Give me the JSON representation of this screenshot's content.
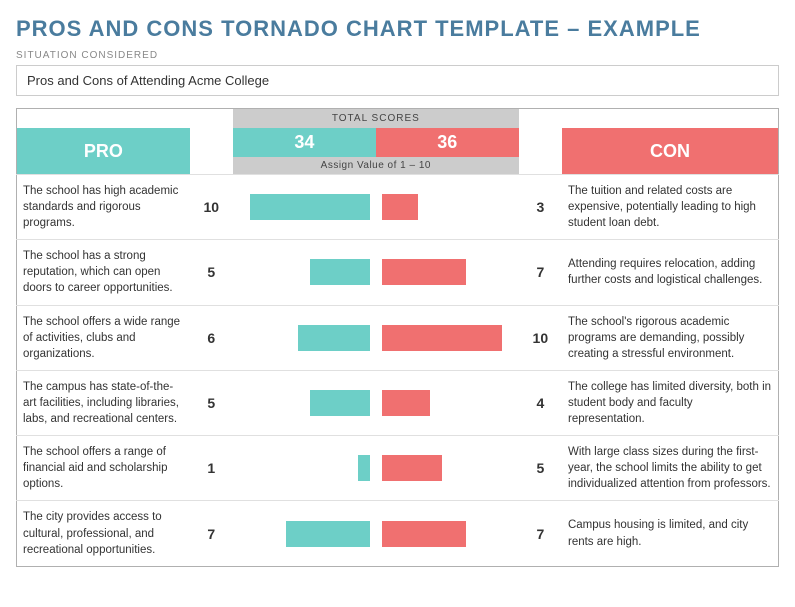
{
  "title": "PROS AND CONS TORNADO CHART TEMPLATE – EXAMPLE",
  "situation_label": "SITUATION CONSIDERED",
  "situation_value": "Pros and Cons of Attending Acme College",
  "total_scores_label": "TOTAL SCORES",
  "assign_value_label": "Assign Value of 1 – 10",
  "pro_label": "PRO",
  "con_label": "CON",
  "pro_total": "34",
  "con_total": "36",
  "max_bar_width": 120,
  "max_val": 10,
  "rows": [
    {
      "pro_text": "The school has high academic standards and rigorous programs.",
      "pro_val": 10,
      "con_val": 3,
      "con_text": "The tuition and related costs are expensive, potentially leading to high student loan debt."
    },
    {
      "pro_text": "The school has a strong reputation, which can open doors to career opportunities.",
      "pro_val": 5,
      "con_val": 7,
      "con_text": "Attending requires relocation, adding further costs and logistical challenges."
    },
    {
      "pro_text": "The school offers a wide range of activities, clubs and organizations.",
      "pro_val": 6,
      "con_val": 10,
      "con_text": "The school's rigorous academic programs are demanding, possibly creating a stressful environment."
    },
    {
      "pro_text": "The campus has state-of-the-art facilities, including libraries, labs, and recreational centers.",
      "pro_val": 5,
      "con_val": 4,
      "con_text": "The college has limited diversity, both in student body and faculty representation."
    },
    {
      "pro_text": "The school offers a range of financial aid and scholarship options.",
      "pro_val": 1,
      "con_val": 5,
      "con_text": "With large class sizes during the first-year, the school limits the ability to get individualized attention from professors."
    },
    {
      "pro_text": "The city provides access to cultural, professional, and recreational opportunities.",
      "pro_val": 7,
      "con_val": 7,
      "con_text": "Campus housing is limited, and city rents are high."
    }
  ]
}
